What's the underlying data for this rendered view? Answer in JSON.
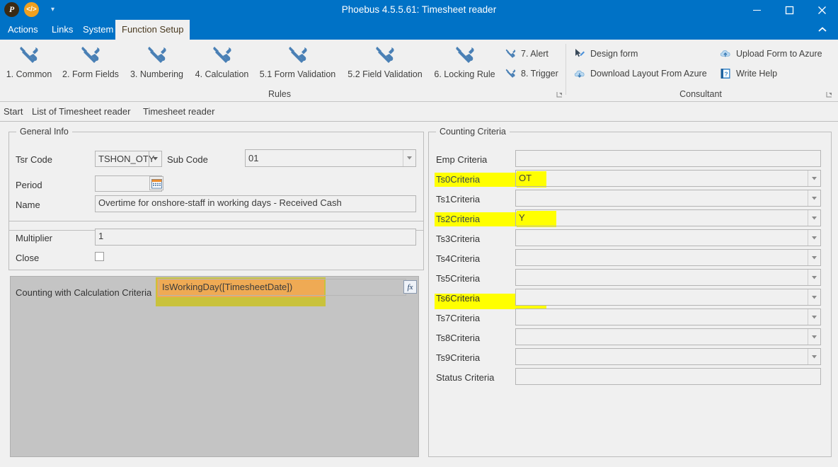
{
  "window": {
    "title": "Phoebus 4.5.5.61: Timesheet reader",
    "quick_access": [
      {
        "name": "phoebus-logo-icon",
        "glyph": "P"
      },
      {
        "name": "code-icon",
        "glyph": "</>"
      },
      {
        "name": "customize-quick-access-icon",
        "glyph": "▾"
      }
    ],
    "controls": [
      {
        "name": "minimize-button",
        "label": "─"
      },
      {
        "name": "maximize-button",
        "label": "□"
      },
      {
        "name": "close-button",
        "label": "✕"
      }
    ],
    "collapse_ribbon": "˄"
  },
  "menubar": {
    "items": [
      {
        "label": "Actions",
        "active": false
      },
      {
        "label": "Links",
        "active": false
      },
      {
        "label": "System",
        "active": false
      },
      {
        "label": "Function Setup",
        "active": true
      }
    ]
  },
  "ribbon": {
    "rules_group": {
      "label": "Rules",
      "big_buttons": [
        {
          "label": "1. Common",
          "icon": "tools-icon"
        },
        {
          "label": "2. Form Fields",
          "icon": "tools-icon"
        },
        {
          "label": "3. Numbering",
          "icon": "tools-icon"
        },
        {
          "label": "4. Calculation",
          "icon": "tools-icon"
        },
        {
          "label": "5.1 Form Validation",
          "icon": "tools-icon"
        },
        {
          "label": "5.2 Field Validation",
          "icon": "tools-icon"
        },
        {
          "label": "6. Locking Rule",
          "icon": "tools-icon"
        }
      ],
      "small_buttons": [
        {
          "label": "7. Alert",
          "icon": "tools-icon"
        },
        {
          "label": "8. Trigger",
          "icon": "tools-icon"
        }
      ]
    },
    "consultant_group": {
      "label": "Consultant",
      "buttons": [
        {
          "label": "Design form",
          "icon": "cursor-pen-icon"
        },
        {
          "label": "Download Layout From Azure",
          "icon": "cloud-download-icon"
        },
        {
          "label": "Upload Form to Azure",
          "icon": "cloud-upload-icon"
        },
        {
          "label": "Write Help",
          "icon": "help-book-icon"
        }
      ]
    }
  },
  "doctabs": {
    "items": [
      {
        "label": "Start",
        "active": false
      },
      {
        "label": "List of Timesheet reader",
        "active": false
      },
      {
        "label": "Timesheet reader",
        "active": true
      }
    ]
  },
  "general_info": {
    "title": "General Info",
    "tsr_code_label": "Tsr Code",
    "tsr_code_value": "TSHON_OTY",
    "sub_code_label": "Sub Code",
    "sub_code_value": "01",
    "period_label": "Period",
    "period_value": "",
    "period_icon": "calendar-icon",
    "name_label": "Name",
    "name_value": "Overtime for onshore-staff in working days - Received Cash",
    "multiplier_label": "Multiplier",
    "multiplier_value": "1",
    "close_label": "Close",
    "close_checked": false
  },
  "calculation": {
    "label": "Counting with Calculation Criteria",
    "formula": "IsWorkingDay([TimesheetDate])",
    "fx_button_label": "fx",
    "highlight_inner_color": "#efaa54",
    "highlight_outer_color": "#c9c23c"
  },
  "counting_criteria": {
    "title": "Counting Criteria",
    "highlight_color": "#ffff00",
    "rows": [
      {
        "label": "Emp Criteria",
        "value": "",
        "type": "text",
        "highlighted": false
      },
      {
        "label": "Ts0Criteria",
        "value": "OT",
        "type": "combo",
        "highlighted": true
      },
      {
        "label": "Ts1Criteria",
        "value": "",
        "type": "combo",
        "highlighted": false
      },
      {
        "label": "Ts2Criteria",
        "value": "Y",
        "type": "combo",
        "highlighted": true
      },
      {
        "label": "Ts3Criteria",
        "value": "",
        "type": "combo",
        "highlighted": false
      },
      {
        "label": "Ts4Criteria",
        "value": "",
        "type": "combo",
        "highlighted": false
      },
      {
        "label": "Ts5Criteria",
        "value": "",
        "type": "combo",
        "highlighted": false
      },
      {
        "label": "Ts6Criteria",
        "value": "",
        "type": "combo",
        "highlighted": false
      },
      {
        "label": "Ts7Criteria",
        "value": "",
        "type": "combo",
        "highlighted": false
      },
      {
        "label": "Ts8Criteria",
        "value": "",
        "type": "combo",
        "highlighted": false
      },
      {
        "label": "Ts9Criteria",
        "value": "",
        "type": "combo",
        "highlighted": false
      },
      {
        "label": "Status Criteria",
        "value": "",
        "type": "text",
        "highlighted": false
      }
    ]
  }
}
